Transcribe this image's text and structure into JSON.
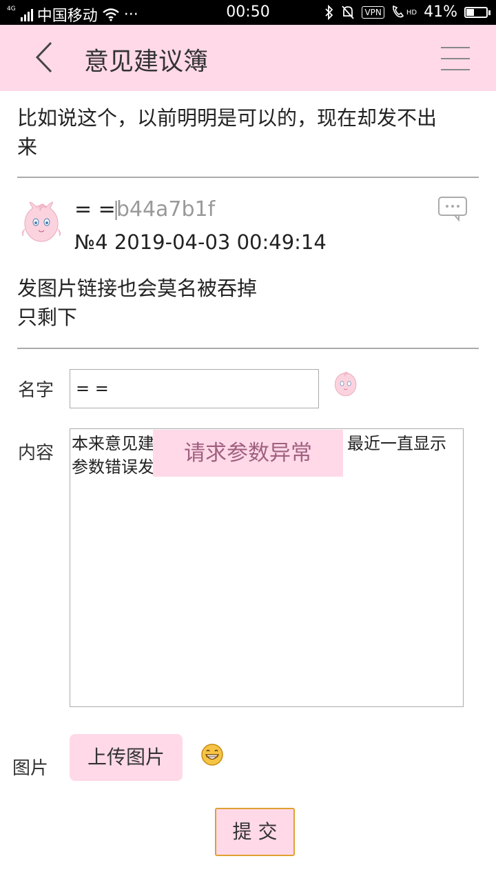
{
  "status_bar": {
    "network": "4G",
    "carrier": "中国移动",
    "dots": "···",
    "time": "00:50",
    "vpn": "VPN",
    "hd": "HD",
    "battery": "41%",
    "battery_level": 0.41
  },
  "header": {
    "title": "意见建议簿"
  },
  "post_prev": {
    "text_line1": "比如说这个，以前明明是可以的，现在却发不出",
    "text_line2": "来"
  },
  "post4": {
    "name": "= =",
    "hash": "b44a7b1f",
    "meta": "№4  2019-04-03 00:49:14",
    "text_line1": "发图片链接也会莫名被吞掉",
    "text_line2": "只剩下"
  },
  "form": {
    "name_label": "名字",
    "name_value": "= =",
    "content_label": "内容",
    "content_line1": "本来意见建",
    "content_line1_tail": "最近一直显示",
    "content_line2": "参数错误发",
    "image_label": "图片",
    "upload_label": "上传图片",
    "submit_label": "提 交"
  },
  "toast": {
    "message": "请求参数异常"
  },
  "colors": {
    "accent_pink": "#ffd9e8",
    "submit_border": "#e0a030"
  }
}
